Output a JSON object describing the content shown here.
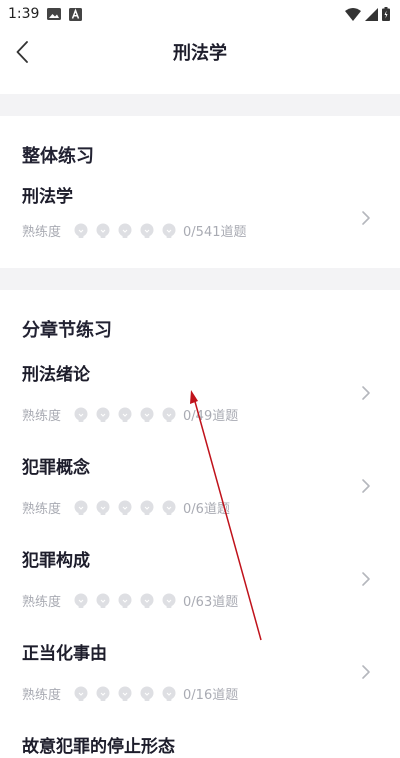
{
  "status": {
    "time": "1:39"
  },
  "nav": {
    "title": "刑法学"
  },
  "overall": {
    "header": "整体练习",
    "item": {
      "title": "刑法学",
      "proficiency_label": "熟练度",
      "count": "0/541道题"
    }
  },
  "chapters": {
    "header": "分章节练习",
    "items": [
      {
        "title": "刑法绪论",
        "proficiency_label": "熟练度",
        "count": "0/49道题"
      },
      {
        "title": "犯罪概念",
        "proficiency_label": "熟练度",
        "count": "0/6道题"
      },
      {
        "title": "犯罪构成",
        "proficiency_label": "熟练度",
        "count": "0/63道题"
      },
      {
        "title": "正当化事由",
        "proficiency_label": "熟练度",
        "count": "0/16道题"
      },
      {
        "title": "故意犯罪的停止形态"
      }
    ]
  },
  "colors": {
    "arrow": "#c0121b",
    "muted": "#a9abb3",
    "divider": "#f3f3f5"
  }
}
